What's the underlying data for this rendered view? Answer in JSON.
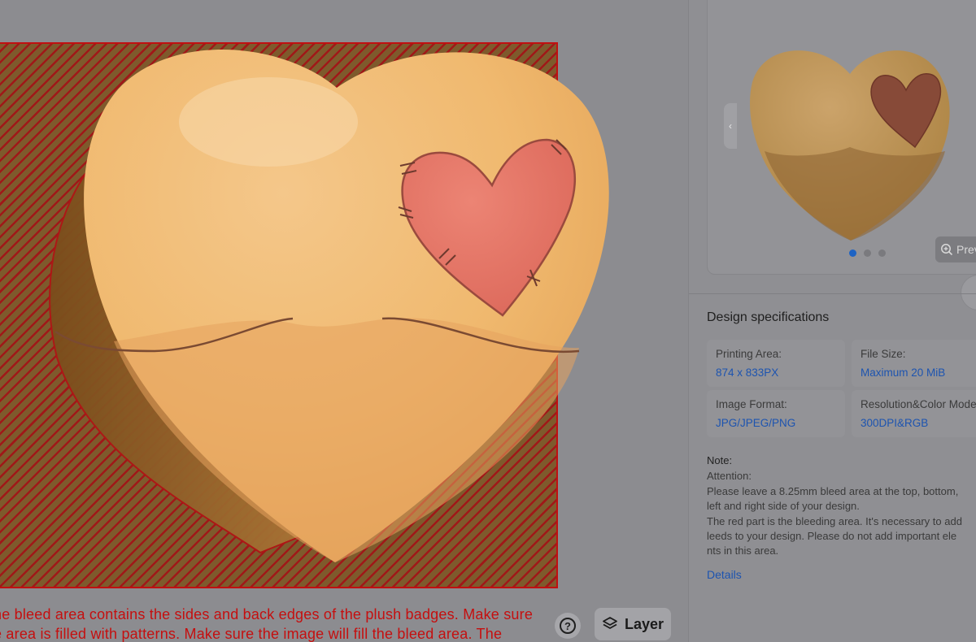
{
  "canvas": {
    "bleed_notice_lines": [
      "he bleed area contains the sides and back edges of the plush badges. Make sure",
      "e area is filled with patterns. Make sure the image will fill the bleed area. The"
    ],
    "help_icon_glyph": "?",
    "layer_label": "Layer",
    "colors": {
      "bleed_red": "#c01010",
      "notice_red": "#c50f0f"
    }
  },
  "preview": {
    "collapse_glyph": "‹",
    "preview_label": "Preview",
    "dots": {
      "count": 3,
      "active_index": 0
    }
  },
  "specs": {
    "title": "Design specifications",
    "items": [
      {
        "label": "Printing Area:",
        "value": "874 x 833PX"
      },
      {
        "label": "File Size:",
        "value": "Maximum 20 MiB"
      },
      {
        "label": "Image Format:",
        "value": "JPG/JPEG/PNG"
      },
      {
        "label": "Resolution&Color Mode",
        "value": "300DPI&RGB"
      }
    ]
  },
  "note": {
    "title": "Note:",
    "lines": [
      "Attention:",
      "Please leave a 8.25mm bleed area at the top, bottom,",
      "left and right side of your design.",
      "The red part is the bleeding area. It's necessary to add",
      "leeds to your design. Please do not add important ele",
      "nts in this area."
    ],
    "details_label": "Details"
  },
  "colors": {
    "link_blue": "#1d54b0",
    "accent_blue": "#1d63c4"
  }
}
